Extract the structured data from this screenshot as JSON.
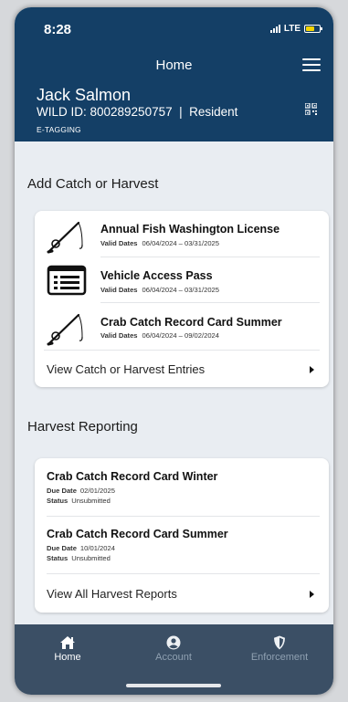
{
  "status_bar": {
    "time": "8:28",
    "network": "LTE"
  },
  "header": {
    "title": "Home",
    "user_name": "Jack Salmon",
    "wild_id_line": "WILD ID: 800289250757  |  Resident",
    "subtext": "E-TAGGING"
  },
  "catch_section": {
    "title": "Add Catch or Harvest",
    "items": [
      {
        "icon": "fishing-rod-icon",
        "title": "Annual Fish Washington License",
        "dates_label": "Valid Dates",
        "dates": "06/04/2024 – 03/31/2025"
      },
      {
        "icon": "pass-card-icon",
        "title": "Vehicle Access Pass",
        "dates_label": "Valid Dates",
        "dates": "06/04/2024 – 03/31/2025"
      },
      {
        "icon": "fishing-rod-icon",
        "title": "Crab Catch Record Card Summer",
        "dates_label": "Valid Dates",
        "dates": "06/04/2024 – 09/02/2024"
      }
    ],
    "view_link": "View Catch or Harvest Entries"
  },
  "harvest_section": {
    "title": "Harvest Reporting",
    "items": [
      {
        "title": "Crab Catch Record Card Winter",
        "due_label": "Due Date",
        "due": "02/01/2025",
        "status_label": "Status",
        "status": "Unsubmitted"
      },
      {
        "title": "Crab Catch Record Card Summer",
        "due_label": "Due Date",
        "due": "10/01/2024",
        "status_label": "Status",
        "status": "Unsubmitted"
      }
    ],
    "view_link": "View All Harvest Reports"
  },
  "tabs": [
    {
      "label": "Home",
      "icon": "home-icon",
      "active": true
    },
    {
      "label": "Account",
      "icon": "account-icon",
      "active": false
    },
    {
      "label": "Enforcement",
      "icon": "shield-icon",
      "active": false
    }
  ],
  "colors": {
    "header": "#143f66",
    "tabbar": "#3b4f65",
    "background": "#e9edf2",
    "battery": "#f5d400"
  }
}
